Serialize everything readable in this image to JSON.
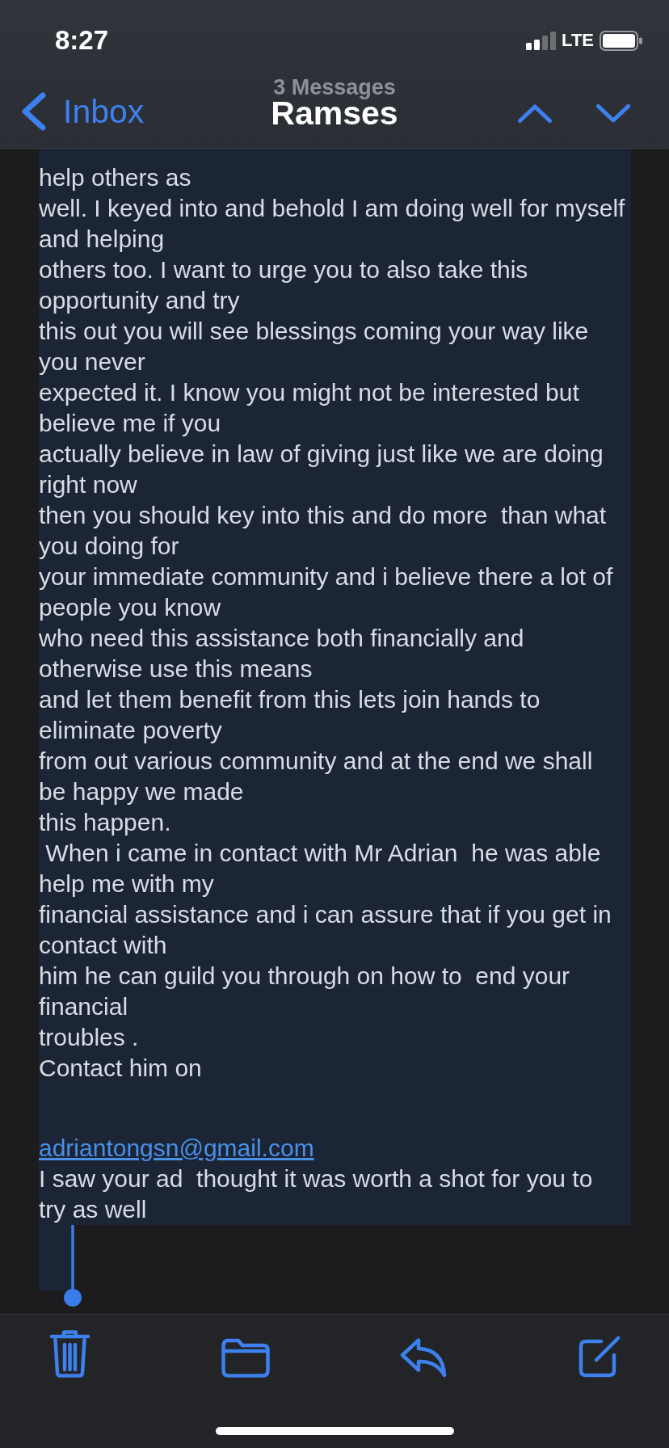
{
  "status_bar": {
    "time": "8:27",
    "network": "LTE"
  },
  "nav_bar": {
    "back_label": "Inbox",
    "subtitle": "3 Messages",
    "title": "Ramses"
  },
  "message": {
    "selected": true,
    "lines": [
      {
        "kind": "text",
        "text": "help others as"
      },
      {
        "kind": "text",
        "text": "well. I keyed into and behold I am doing well for myself"
      },
      {
        "kind": "text",
        "text": "and helping"
      },
      {
        "kind": "text",
        "text": "others too. I want to urge you to also take this"
      },
      {
        "kind": "text",
        "text": "opportunity and try"
      },
      {
        "kind": "text",
        "text": "this out you will see blessings coming your way like"
      },
      {
        "kind": "text",
        "text": "you never"
      },
      {
        "kind": "text",
        "text": "expected it. I know you might not be interested but"
      },
      {
        "kind": "text",
        "text": "believe me if you"
      },
      {
        "kind": "text",
        "text": "actually believe in law of giving just like we are doing"
      },
      {
        "kind": "text",
        "text": "right now"
      },
      {
        "kind": "text",
        "text": "then you should key into this and do more  than what"
      },
      {
        "kind": "text",
        "text": "you doing for"
      },
      {
        "kind": "text",
        "text": "your immediate community and i believe there a lot of"
      },
      {
        "kind": "text",
        "text": "people you know"
      },
      {
        "kind": "text",
        "text": "who need this assistance both financially and"
      },
      {
        "kind": "text",
        "text": "otherwise use this means"
      },
      {
        "kind": "text",
        "text": "and let them benefit from this lets join hands to"
      },
      {
        "kind": "text",
        "text": "eliminate poverty"
      },
      {
        "kind": "text",
        "text": "from out various community and at the end we shall"
      },
      {
        "kind": "text",
        "text": "be happy we made"
      },
      {
        "kind": "text",
        "text": "this happen."
      },
      {
        "kind": "text",
        "text": " When i came in contact with Mr Adrian  he was able"
      },
      {
        "kind": "text",
        "text": "help me with my"
      },
      {
        "kind": "text",
        "text": "financial assistance and i can assure that if you get in"
      },
      {
        "kind": "text",
        "text": "contact with"
      },
      {
        "kind": "text",
        "text": "him he can guild you through on how to  end your"
      },
      {
        "kind": "text",
        "text": "financial"
      },
      {
        "kind": "text",
        "text": "troubles ."
      },
      {
        "kind": "text",
        "text": "Contact him on"
      },
      {
        "kind": "link",
        "text": "adriantongsn@gmail.com"
      },
      {
        "kind": "text",
        "text": "I saw your ad  thought it was worth a shot for you to"
      },
      {
        "kind": "text",
        "text": "try as well"
      }
    ]
  }
}
